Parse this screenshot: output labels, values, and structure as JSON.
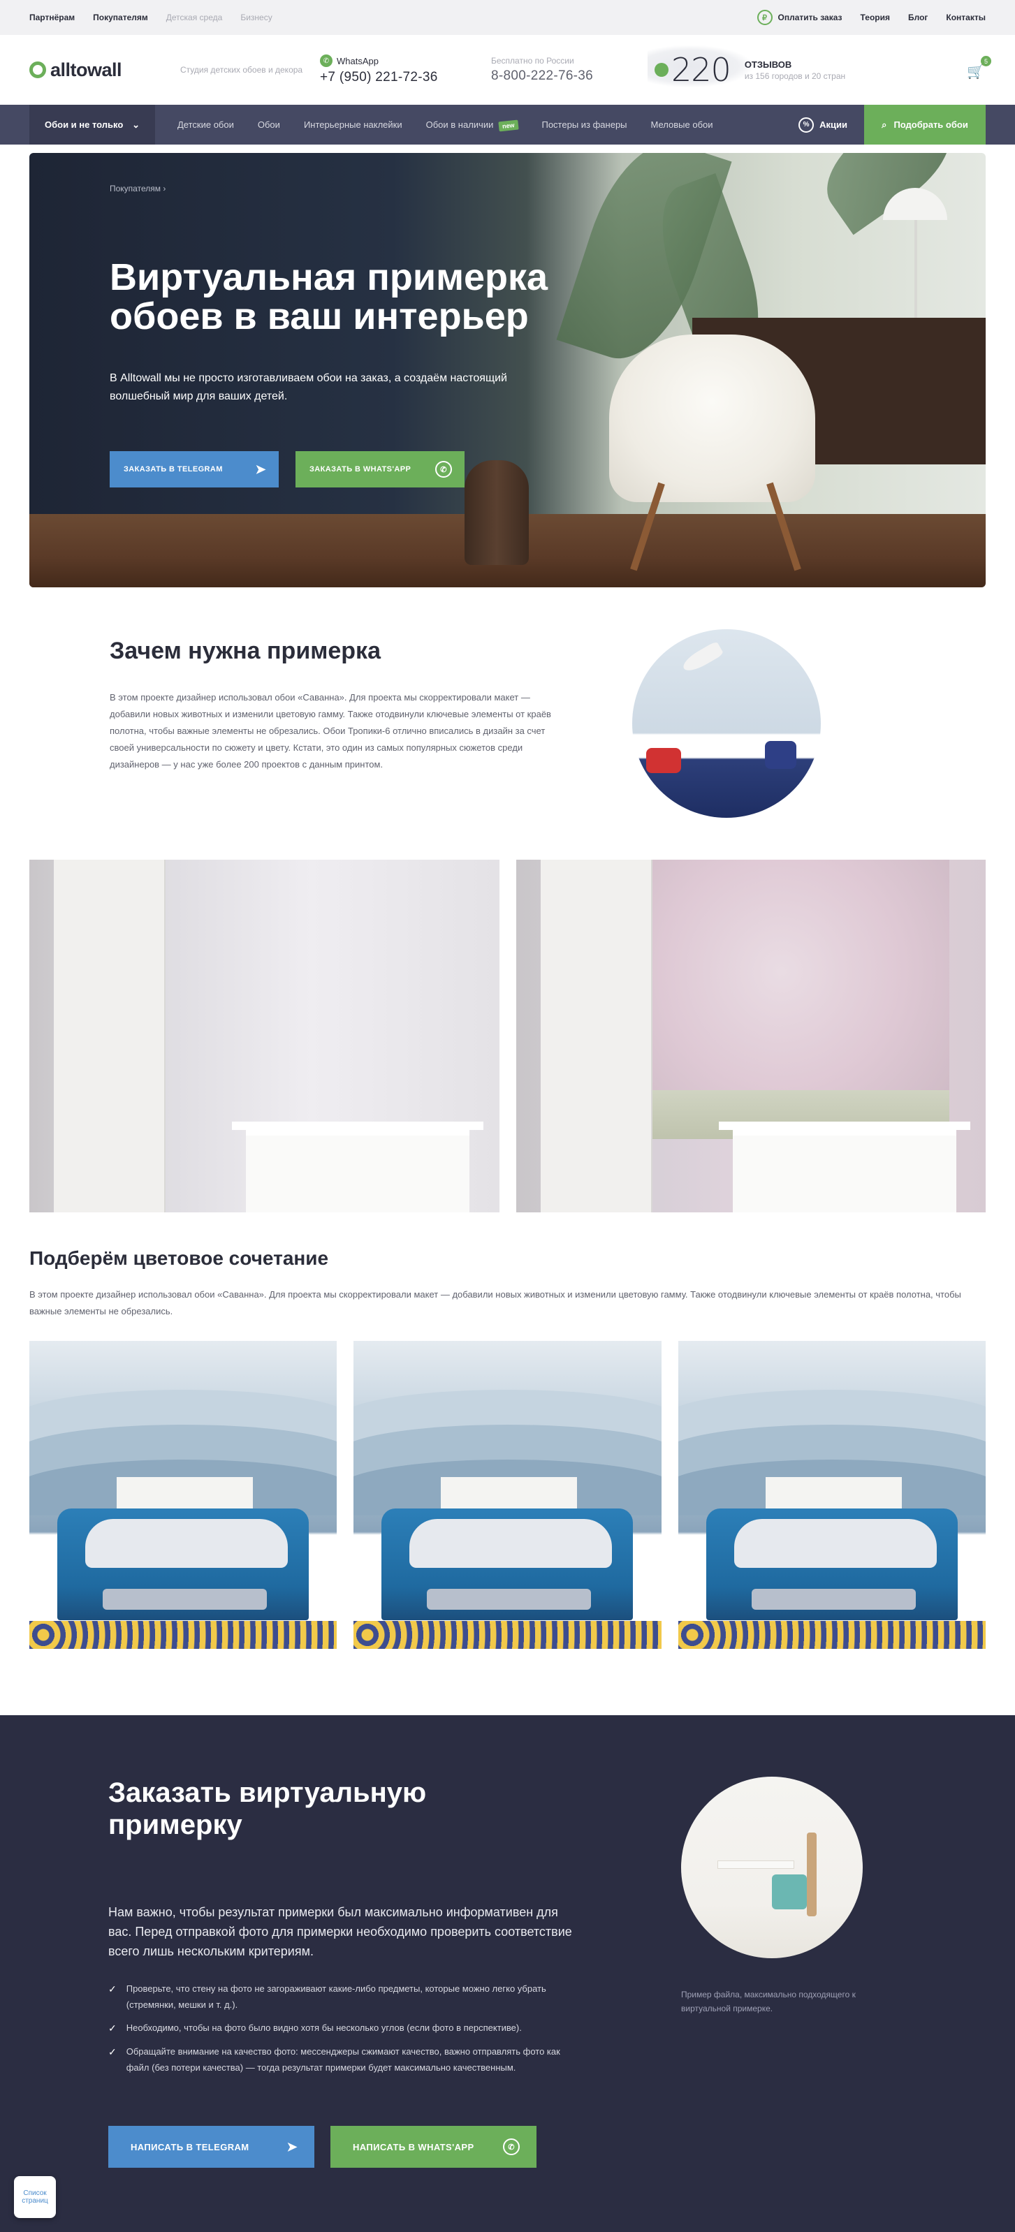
{
  "topbar": {
    "links": [
      "Партнёрам",
      "Покупателям"
    ],
    "muted_links": [
      "Детская среда",
      "Бизнесу"
    ],
    "pay_label": "Оплатить заказ",
    "pay_icon": "ruble-icon",
    "right_links": [
      "Теория",
      "Блог",
      "Контакты"
    ]
  },
  "header": {
    "logo_text": "alltowall",
    "tagline": "Студия детских обоев и декора",
    "whatsapp_label": "WhatsApp",
    "whatsapp_phone": "+7 (950) 221-72-36",
    "free_label": "Бесплатно по России",
    "free_phone": "8-800-222-76-36",
    "reviews_count": "220",
    "reviews_title": "ОТЗЫВОВ",
    "reviews_sub": "из 156 городов и 20 стран",
    "cart_count": "5"
  },
  "nav": {
    "catalog": "Обои и не только",
    "items": [
      "Детские обои",
      "Обои",
      "Интерьерные наклейки",
      "Обои в наличии",
      "Постеры из фанеры",
      "Меловые обои"
    ],
    "new_badge": "new",
    "sale": "Акции",
    "pick": "Подобрать обои"
  },
  "hero": {
    "breadcrumb": "Покупателям",
    "title": "Виртуальная примерка обоев в ваш интерьер",
    "lead": "В Alltowall мы не просто изготавливаем обои на заказ, а создаём настоящий волшебный мир для ваших детей.",
    "btn_telegram": "Заказать в Telegram",
    "btn_whatsapp": "Заказать в Whats'app"
  },
  "why": {
    "title": "Зачем нужна примерка",
    "text": "В этом проекте дизайнер использовал обои «Саванна». Для проекта мы скорректировали макет — добавили новых животных и изменили цветовую гамму. Также отодвинули ключевые элементы от краёв полотна, чтобы важные элементы не обрезались. Обои Тропики-6 отлично вписались в дизайн за счет своей универсальности по сюжету и цвету. Кстати, это один из самых популярных сюжетов среди дизайнеров — у нас уже более 200 проектов с данным принтом."
  },
  "combo": {
    "title": "Подберём цветовое сочетание",
    "text": "В этом проекте дизайнер использовал обои «Саванна». Для проекта мы скорректировали макет — добавили новых животных и изменили цветовую гамму. Также отодвинули ключевые элементы от краёв полотна, чтобы важные элементы не обрезались."
  },
  "order": {
    "title": "Заказать виртуальную примерку",
    "lead": "Нам важно, чтобы результат примерки был максимально информативен для вас. Перед отправкой фото для примерки необходимо проверить соответствие всего лишь нескольким критериям.",
    "checklist": [
      "Проверьте, что стену на фото не загораживают какие-либо предметы, которые можно легко убрать (стремянки, мешки и т. д.).",
      "Необходимо, чтобы на фото было видно хотя бы несколько углов (если фото в перспективе).",
      "Обращайте внимание на качество фото: мессенджеры сжимают качество, важно отправлять фото как файл (без потери качества) — тогда результат примерки будет максимально качественным."
    ],
    "caption": "Пример файла, максимально подходящего к виртуальной примерке.",
    "btn_telegram": "Написать в Telegram",
    "btn_whatsapp": "Написать в Whats'app"
  },
  "float_badge": "Список страниц",
  "colors": {
    "accent_green": "#6caf5a",
    "telegram_blue": "#4c8ccc",
    "dark_navy": "#2b2d42",
    "nav_bg": "#454963"
  }
}
